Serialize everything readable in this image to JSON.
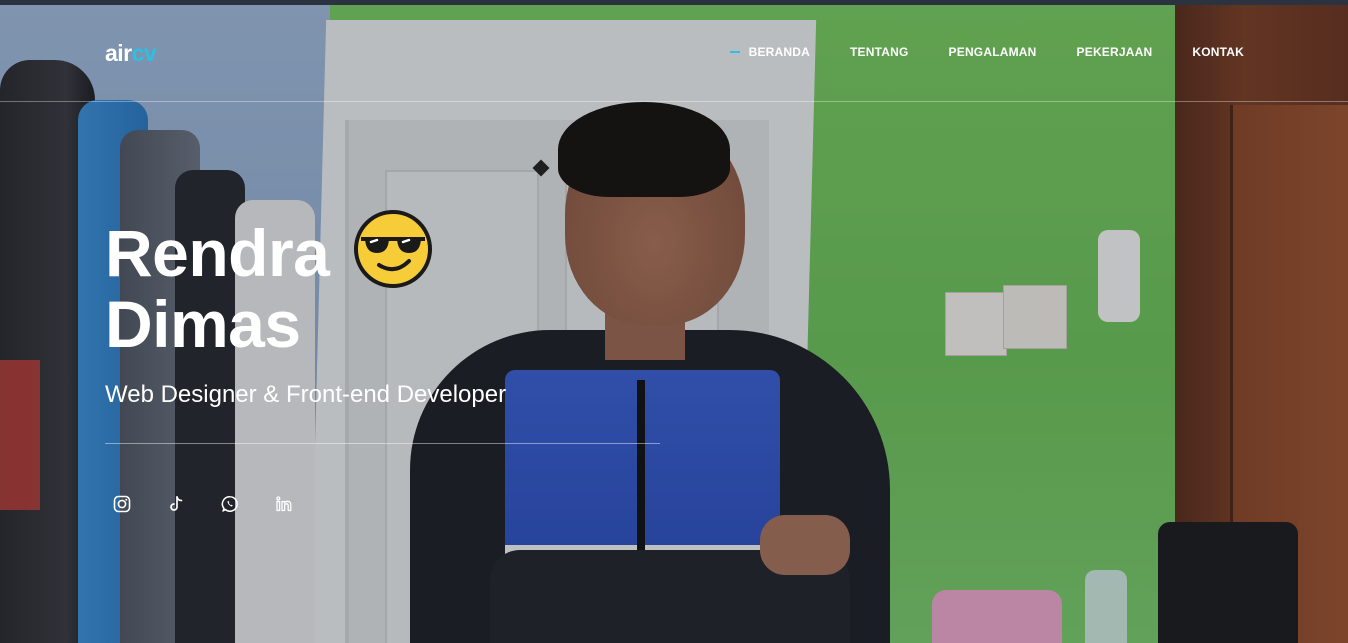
{
  "brand": {
    "logo_prefix": "air",
    "logo_suffix": "cv",
    "accent_color": "#2bc0e4"
  },
  "nav": {
    "items": [
      {
        "label": "BERANDA",
        "active": true
      },
      {
        "label": "TENTANG",
        "active": false
      },
      {
        "label": "PENGALAMAN",
        "active": false
      },
      {
        "label": "PEKERJAAN",
        "active": false
      },
      {
        "label": "KONTAK",
        "active": false
      }
    ]
  },
  "hero": {
    "first_name": "Rendra",
    "last_name": "Dimas",
    "emoji": "smiling-face-with-sunglasses",
    "role": "Web Designer & Front-end Developer"
  },
  "socials": [
    {
      "icon": "instagram-icon"
    },
    {
      "icon": "tiktok-icon"
    },
    {
      "icon": "whatsapp-icon"
    },
    {
      "icon": "linkedin-icon"
    }
  ]
}
